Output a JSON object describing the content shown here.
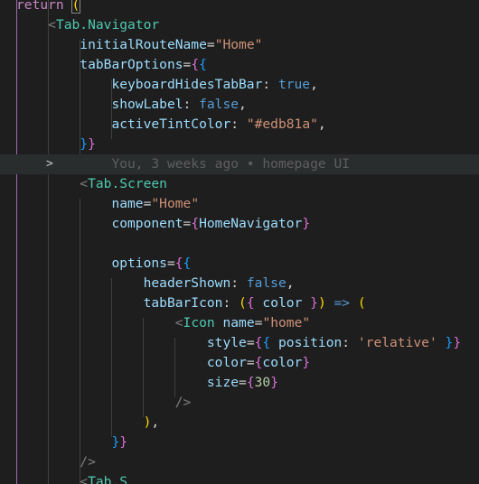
{
  "code_lines": [
    [
      {
        "t": "return",
        "c": "kw"
      },
      {
        "t": " ",
        "c": "txt"
      },
      {
        "t": "(",
        "c": "b1"
      }
    ],
    [
      {
        "t": "    ",
        "c": "txt"
      },
      {
        "t": "<",
        "c": "punc"
      },
      {
        "t": "Tab.Navigator",
        "c": "tag"
      }
    ],
    [
      {
        "t": "        ",
        "c": "txt"
      },
      {
        "t": "initialRouteName",
        "c": "attr"
      },
      {
        "t": "=",
        "c": "op"
      },
      {
        "t": "\"Home\"",
        "c": "str"
      }
    ],
    [
      {
        "t": "        ",
        "c": "txt"
      },
      {
        "t": "tabBarOptions",
        "c": "attr"
      },
      {
        "t": "=",
        "c": "op"
      },
      {
        "t": "{",
        "c": "b2"
      },
      {
        "t": "{",
        "c": "b3"
      }
    ],
    [
      {
        "t": "            ",
        "c": "txt"
      },
      {
        "t": "keyboardHidesTabBar",
        "c": "attr"
      },
      {
        "t": ": ",
        "c": "txt"
      },
      {
        "t": "true",
        "c": "bool"
      },
      {
        "t": ",",
        "c": "txt"
      }
    ],
    [
      {
        "t": "            ",
        "c": "txt"
      },
      {
        "t": "showLabel",
        "c": "attr"
      },
      {
        "t": ": ",
        "c": "txt"
      },
      {
        "t": "false",
        "c": "bool"
      },
      {
        "t": ",",
        "c": "txt"
      }
    ],
    [
      {
        "t": "            ",
        "c": "txt"
      },
      {
        "t": "activeTintColor",
        "c": "attr"
      },
      {
        "t": ": ",
        "c": "txt"
      },
      {
        "t": "\"#edb81a\"",
        "c": "str"
      },
      {
        "t": ",",
        "c": "txt"
      }
    ],
    [
      {
        "t": "        ",
        "c": "txt"
      },
      {
        "t": "}",
        "c": "b3"
      },
      {
        "t": "}",
        "c": "b2"
      }
    ],
    [
      {
        "t": "            ",
        "c": "txt"
      },
      {
        "t": "You, 3 weeks ago • homepage UI",
        "c": "blame"
      }
    ],
    [
      {
        "t": "        ",
        "c": "txt"
      },
      {
        "t": "<",
        "c": "punc"
      },
      {
        "t": "Tab.Screen",
        "c": "tag"
      }
    ],
    [
      {
        "t": "            ",
        "c": "txt"
      },
      {
        "t": "name",
        "c": "attr"
      },
      {
        "t": "=",
        "c": "op"
      },
      {
        "t": "\"Home\"",
        "c": "str"
      }
    ],
    [
      {
        "t": "            ",
        "c": "txt"
      },
      {
        "t": "component",
        "c": "attr"
      },
      {
        "t": "=",
        "c": "op"
      },
      {
        "t": "{",
        "c": "b2"
      },
      {
        "t": "HomeNavigator",
        "c": "attr"
      },
      {
        "t": "}",
        "c": "b2"
      }
    ],
    [],
    [
      {
        "t": "            ",
        "c": "txt"
      },
      {
        "t": "options",
        "c": "attr"
      },
      {
        "t": "=",
        "c": "op"
      },
      {
        "t": "{",
        "c": "b2"
      },
      {
        "t": "{",
        "c": "b3"
      }
    ],
    [
      {
        "t": "                ",
        "c": "txt"
      },
      {
        "t": "headerShown",
        "c": "attr"
      },
      {
        "t": ": ",
        "c": "txt"
      },
      {
        "t": "false",
        "c": "bool"
      },
      {
        "t": ",",
        "c": "txt"
      }
    ],
    [
      {
        "t": "                ",
        "c": "txt"
      },
      {
        "t": "tabBarIcon",
        "c": "attr"
      },
      {
        "t": ": ",
        "c": "txt"
      },
      {
        "t": "(",
        "c": "b1"
      },
      {
        "t": "{ ",
        "c": "b2"
      },
      {
        "t": "color",
        "c": "attr"
      },
      {
        "t": " }",
        "c": "b2"
      },
      {
        "t": ")",
        "c": "b1"
      },
      {
        "t": " => ",
        "c": "bool"
      },
      {
        "t": "(",
        "c": "b1"
      }
    ],
    [
      {
        "t": "                    ",
        "c": "txt"
      },
      {
        "t": "<",
        "c": "punc"
      },
      {
        "t": "Icon",
        "c": "tag"
      },
      {
        "t": " ",
        "c": "txt"
      },
      {
        "t": "name",
        "c": "attr"
      },
      {
        "t": "=",
        "c": "op"
      },
      {
        "t": "\"home\"",
        "c": "str"
      }
    ],
    [
      {
        "t": "                        ",
        "c": "txt"
      },
      {
        "t": "style",
        "c": "attr"
      },
      {
        "t": "=",
        "c": "op"
      },
      {
        "t": "{",
        "c": "b2"
      },
      {
        "t": "{",
        "c": "b3"
      },
      {
        "t": " ",
        "c": "txt"
      },
      {
        "t": "position",
        "c": "attr"
      },
      {
        "t": ": ",
        "c": "txt"
      },
      {
        "t": "'relative'",
        "c": "str"
      },
      {
        "t": " ",
        "c": "txt"
      },
      {
        "t": "}",
        "c": "b3"
      },
      {
        "t": "}",
        "c": "b2"
      }
    ],
    [
      {
        "t": "                        ",
        "c": "txt"
      },
      {
        "t": "color",
        "c": "attr"
      },
      {
        "t": "=",
        "c": "op"
      },
      {
        "t": "{",
        "c": "b2"
      },
      {
        "t": "color",
        "c": "attr"
      },
      {
        "t": "}",
        "c": "b2"
      }
    ],
    [
      {
        "t": "                        ",
        "c": "txt"
      },
      {
        "t": "size",
        "c": "attr"
      },
      {
        "t": "=",
        "c": "op"
      },
      {
        "t": "{",
        "c": "b2"
      },
      {
        "t": "30",
        "c": "num"
      },
      {
        "t": "}",
        "c": "b2"
      }
    ],
    [
      {
        "t": "                    ",
        "c": "txt"
      },
      {
        "t": "/>",
        "c": "punc"
      }
    ],
    [
      {
        "t": "                ",
        "c": "txt"
      },
      {
        "t": ")",
        "c": "b1"
      },
      {
        "t": ",",
        "c": "txt"
      }
    ],
    [
      {
        "t": "            ",
        "c": "txt"
      },
      {
        "t": "}",
        "c": "b3"
      },
      {
        "t": "}",
        "c": "b2"
      }
    ],
    [
      {
        "t": "        ",
        "c": "txt"
      },
      {
        "t": "/>",
        "c": "punc"
      }
    ],
    [
      {
        "t": "        ",
        "c": "txt"
      },
      {
        "t": "<",
        "c": "punc"
      },
      {
        "t": "Tab.S",
        "c": "tag"
      }
    ]
  ],
  "blame_line_index": 8,
  "fold_marker": ">",
  "colors": {
    "background": "#1e1e1e",
    "keyword": "#c586c0",
    "tag": "#4ec9b0",
    "attribute": "#9cdcfe",
    "string": "#ce9178",
    "boolean": "#569cd6",
    "number": "#b5cea8",
    "bracket_gold": "#ffd700",
    "bracket_orchid": "#da70d6",
    "bracket_blue": "#179fff"
  }
}
